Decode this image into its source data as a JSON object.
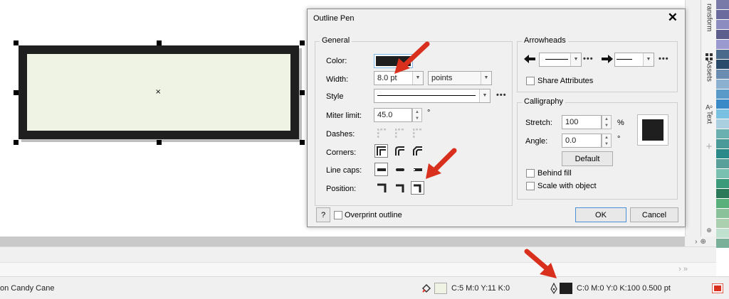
{
  "dialog": {
    "title": "Outline Pen",
    "close_icon": "close-icon",
    "general": {
      "group_title": "General",
      "color_label": "Color:",
      "color_value": "#1f1f1f",
      "width_label": "Width:",
      "width_value": "8.0 pt",
      "units_value": "points",
      "style_label": "Style",
      "miter_label": "Miter limit:",
      "miter_value": "45.0",
      "miter_unit": "°",
      "dashes_label": "Dashes:",
      "corners_label": "Corners:",
      "linecaps_label": "Line caps:",
      "position_label": "Position:"
    },
    "arrowheads": {
      "group_title": "Arrowheads",
      "share_label": "Share Attributes"
    },
    "calligraphy": {
      "group_title": "Calligraphy",
      "stretch_label": "Stretch:",
      "stretch_value": "100",
      "stretch_unit": "%",
      "angle_label": "Angle:",
      "angle_value": "0.0",
      "angle_unit": "°",
      "default_button": "Default",
      "behind_fill_label": "Behind fill",
      "scale_label": "Scale with object"
    },
    "footer": {
      "help_label": "?",
      "overprint_label": "Overprint outline",
      "ok_label": "OK",
      "cancel_label": "Cancel"
    }
  },
  "docker": {
    "tabs": [
      "ransform",
      "Assets",
      "Text"
    ]
  },
  "status": {
    "doc_name": "on Candy Cane",
    "fill_text": "C:5 M:0 Y:11 K:0",
    "fill_color": "#eef3e4",
    "outline_text": "C:0 M:0 Y:0 K:100  0.500 pt",
    "outline_color": "#1f1f1f"
  },
  "palette_colors": [
    "#7a7aa8",
    "#6b6b9e",
    "#8c8cc0",
    "#5e5e8c",
    "#9a9ad0",
    "#4a6a8c",
    "#2a4a6c",
    "#6a8cb0",
    "#8cb0d0",
    "#5a9ac8",
    "#3a8ac8",
    "#7ac0e0",
    "#aad0e0",
    "#6ab0b0",
    "#4a9a9a",
    "#2a8a8a",
    "#5aa09a",
    "#7ac0b0",
    "#3a9a7a",
    "#2a7a5a",
    "#5ab07a",
    "#8ac09a",
    "#aad0b0",
    "#c0e0d0",
    "#7ab09a"
  ],
  "accent_arrow_color": "#d9301e"
}
